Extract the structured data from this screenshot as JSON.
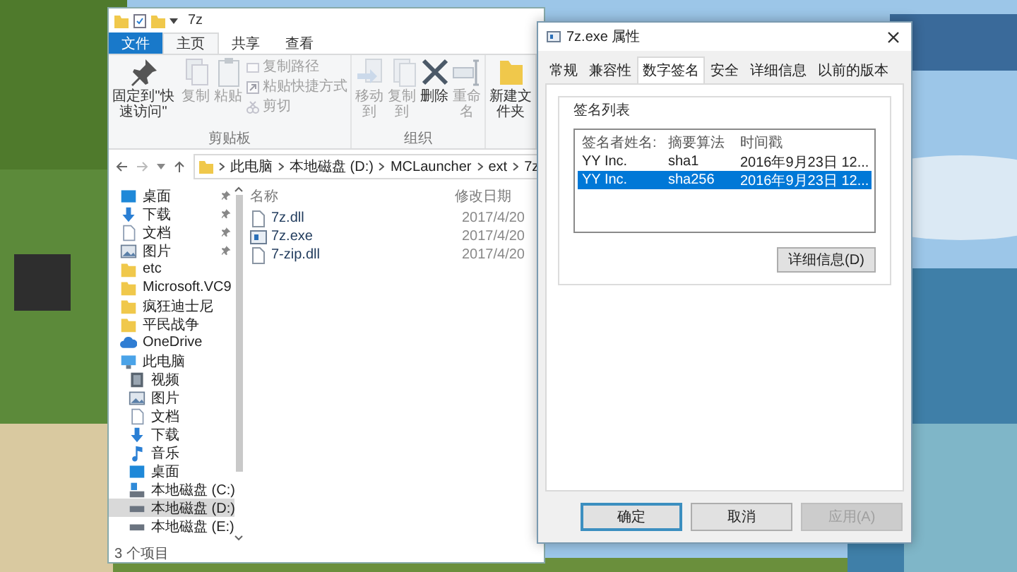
{
  "explorer": {
    "title": "7z",
    "ribbon_tabs": [
      {
        "label": "文件",
        "kind": "file",
        "selected": false
      },
      {
        "label": "主页",
        "kind": "tab",
        "selected": true
      },
      {
        "label": "共享",
        "kind": "tab",
        "selected": false
      },
      {
        "label": "查看",
        "kind": "tab",
        "selected": false
      }
    ],
    "ribbon_groups": [
      {
        "label": "剪贴板",
        "items": [
          {
            "label": "固定到\"快速访问\"",
            "kind": "pin",
            "disabled": false
          },
          {
            "label": "复制",
            "kind": "copy",
            "disabled": true
          },
          {
            "label": "粘贴",
            "kind": "paste",
            "disabled": true
          },
          {
            "label": "复制路径",
            "kind": "copy-path",
            "disabled": true
          },
          {
            "label": "粘贴快捷方式",
            "kind": "shortcut",
            "disabled": true
          },
          {
            "label": "剪切",
            "kind": "cut",
            "disabled": true
          }
        ]
      },
      {
        "label": "组织",
        "items": [
          {
            "label": "移动到",
            "kind": "move",
            "disabled": true
          },
          {
            "label": "复制到",
            "kind": "copy-to",
            "disabled": true
          },
          {
            "label": "删除",
            "kind": "delete",
            "disabled": false
          },
          {
            "label": "重命名",
            "kind": "rename",
            "disabled": true
          }
        ]
      },
      {
        "items": [
          {
            "label": "新建文件夹",
            "kind": "new-folder",
            "disabled": false
          }
        ]
      }
    ],
    "address": [
      "此电脑",
      "本地磁盘 (D:)",
      "MCLauncher",
      "ext",
      "7z"
    ],
    "nav": [
      {
        "label": "桌面",
        "kind": "desktop",
        "pinned": true,
        "selected": false
      },
      {
        "label": "下载",
        "kind": "download",
        "pinned": true,
        "selected": false
      },
      {
        "label": "文档",
        "kind": "document",
        "pinned": true,
        "selected": false
      },
      {
        "label": "图片",
        "kind": "picture",
        "pinned": true,
        "selected": false
      },
      {
        "label": "etc",
        "kind": "folder",
        "pinned": false,
        "selected": false
      },
      {
        "label": "Microsoft.VC9",
        "kind": "folder",
        "pinned": false,
        "selected": false
      },
      {
        "label": "疯狂迪士尼",
        "kind": "folder",
        "pinned": false,
        "selected": false
      },
      {
        "label": "平民战争",
        "kind": "folder",
        "pinned": false,
        "selected": false
      },
      {
        "label": "OneDrive",
        "kind": "cloud",
        "pinned": false,
        "selected": false
      },
      {
        "label": "此电脑",
        "kind": "pc",
        "pinned": false,
        "selected": false,
        "children": [
          {
            "label": "视频",
            "kind": "video",
            "pinned": false,
            "selected": false
          },
          {
            "label": "图片",
            "kind": "picture",
            "pinned": false,
            "selected": false
          },
          {
            "label": "文档",
            "kind": "document",
            "pinned": false,
            "selected": false
          },
          {
            "label": "下载",
            "kind": "download",
            "pinned": false,
            "selected": false
          },
          {
            "label": "音乐",
            "kind": "music",
            "pinned": false,
            "selected": false
          },
          {
            "label": "桌面",
            "kind": "desktop",
            "pinned": false,
            "selected": false
          },
          {
            "label": "本地磁盘 (C:)",
            "kind": "system-drive",
            "pinned": false,
            "selected": false
          },
          {
            "label": "本地磁盘 (D:)",
            "kind": "drive",
            "pinned": false,
            "selected": true
          },
          {
            "label": "本地磁盘 (E:)",
            "kind": "drive",
            "pinned": false,
            "selected": false
          }
        ]
      }
    ],
    "columns": [
      "名称",
      "修改日期"
    ],
    "files": [
      {
        "name": "7z.dll",
        "date": "2017/4/20",
        "kind": "dll"
      },
      {
        "name": "7z.exe",
        "date": "2017/4/20",
        "kind": "exe"
      },
      {
        "name": "7-zip.dll",
        "date": "2017/4/20",
        "kind": "dll"
      }
    ],
    "status": "3 个项目"
  },
  "dialog": {
    "title": "7z.exe 属性",
    "tabs": [
      {
        "label": "常规",
        "selected": false
      },
      {
        "label": "兼容性",
        "selected": false
      },
      {
        "label": "数字签名",
        "selected": true
      },
      {
        "label": "安全",
        "selected": false
      },
      {
        "label": "详细信息",
        "selected": false
      },
      {
        "label": "以前的版本",
        "selected": false
      }
    ],
    "group_label": "签名列表",
    "columns": [
      "签名者姓名:",
      "摘要算法",
      "时间戳"
    ],
    "rows": [
      {
        "cells": [
          "YY Inc.",
          "sha1",
          "2016年9月23日 12..."
        ],
        "selected": false
      },
      {
        "cells": [
          "YY Inc.",
          "sha256",
          "2016年9月23日 12..."
        ],
        "selected": true
      }
    ],
    "details_button": "详细信息(D)",
    "buttons": [
      {
        "label": "确定",
        "kind": "default",
        "disabled": false
      },
      {
        "label": "取消",
        "kind": "normal",
        "disabled": false
      },
      {
        "label": "应用(A)",
        "kind": "normal",
        "disabled": true
      }
    ]
  }
}
